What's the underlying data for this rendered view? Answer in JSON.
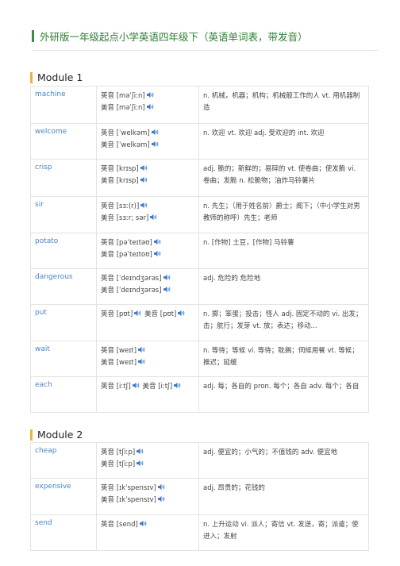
{
  "doc_title": "外研版一年级起点小学英语四年级下（英语单词表，带发音）",
  "labels": {
    "uk": "英音",
    "us": "美音"
  },
  "modules": [
    {
      "title": "Module 1",
      "words": [
        {
          "word": "machine",
          "uk": "[məˈʃiːn]",
          "us": "[məˈʃiːn]",
          "def": "n. 机械，机器；机构；机械般工作的人 vt. 用机器制造"
        },
        {
          "word": "welcome",
          "uk": "[ˈwelkəm]",
          "us": "[ˈwelkəm]",
          "def": "n. 欢迎 vt. 欢迎 adj. 受欢迎的 int. 欢迎"
        },
        {
          "word": "crisp",
          "uk": "[krɪsp]",
          "us": "[krɪsp]",
          "def": "adj. 脆的；新鲜的；易碎的 vt. 使卷曲；使发脆 vi. 卷曲；发脆 n. 松脆物；油炸马铃薯片"
        },
        {
          "word": "sir",
          "uk": "[sɜː(r)]",
          "us": "[sɜːr; sər]",
          "def": "n. 先生；（用于姓名前）爵士；阁下；（中小学生对男教师的称呼）先生；老师"
        },
        {
          "word": "potato",
          "uk": "[pəˈteɪtəʊ]",
          "us": "[pəˈteɪtoʊ]",
          "def": "n. [作物] 土豆，[作物] 马铃薯"
        },
        {
          "word": "dangerous",
          "uk": "[ˈdeɪndʒərəs]",
          "us": "[ˈdeɪndʒərəs]",
          "def": "adj. 危险的 危险地"
        },
        {
          "word": "put",
          "uk": "[pʊt]",
          "us": "[pʊt]",
          "inline": true,
          "def": "n. 掷；笨蛋；投击；怪人 adj. 固定不动的 vi. 出发；击；航行；发芽 vt. 放；表达；移动..."
        },
        {
          "word": "wait",
          "uk": "[weɪt]",
          "us": "[weɪt]",
          "def": "n. 等待；等候 vi. 等待；耽搁；伺候用餐 vt. 等候；推迟；延缓"
        },
        {
          "word": "each",
          "uk": "[iːtʃ]",
          "us": "[iːtʃ]",
          "inline": true,
          "def": "adj. 每；各自的 pron. 每个；各自 adv. 每个；各自"
        }
      ]
    },
    {
      "title": "Module 2",
      "words": [
        {
          "word": "cheap",
          "uk": "[tʃiːp]",
          "us": "[tʃiːp]",
          "def": "adj. 便宜的；小气的；不值钱的 adv. 便宜地"
        },
        {
          "word": "expensive",
          "uk": "[ɪkˈspensɪv]",
          "us": "[ɪkˈspensɪv]",
          "def": "adj. 昂贵的；花钱的"
        },
        {
          "word": "send",
          "uk": "[send]",
          "def": "n. 上升运动 vi. 派人；寄信 vt. 发送，寄；派遣；使进入；发射"
        }
      ]
    }
  ]
}
